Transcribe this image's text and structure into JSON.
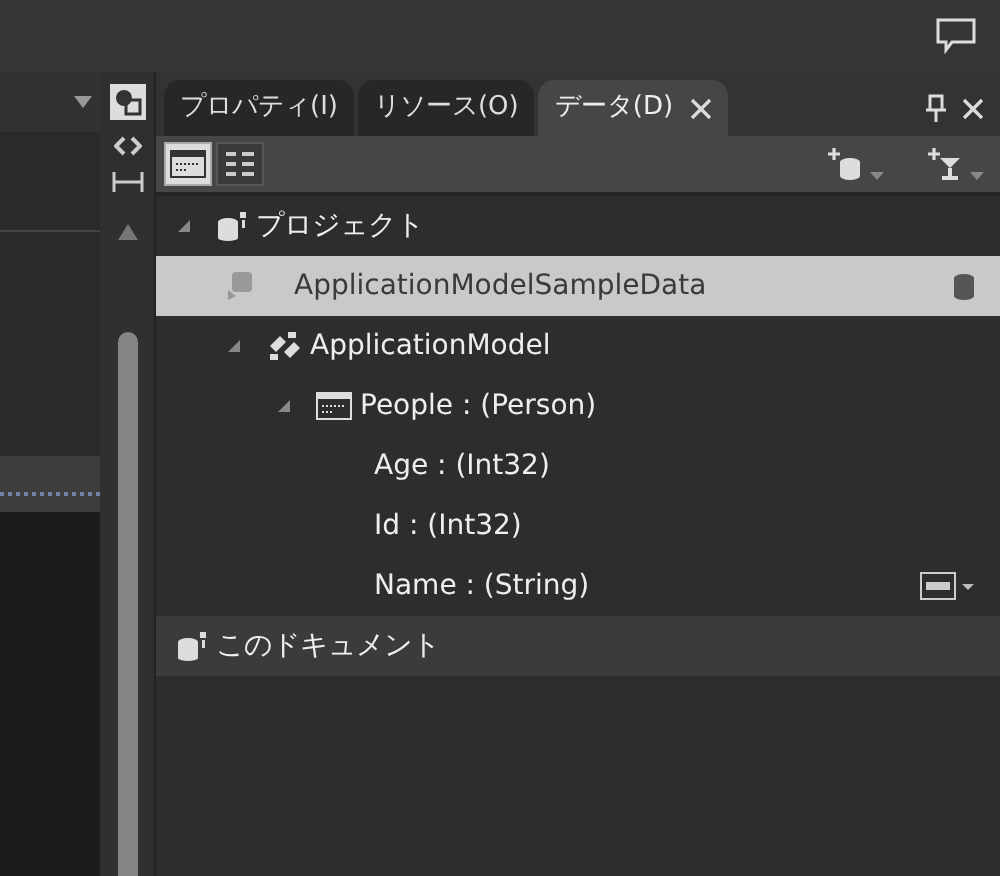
{
  "tabs": [
    {
      "label": "プロパティ(I)",
      "selected": false
    },
    {
      "label": "リソース(O)",
      "selected": false
    },
    {
      "label": "データ(D)",
      "selected": true
    }
  ],
  "view_buttons": [
    {
      "kind": "list",
      "selected": true
    },
    {
      "kind": "details",
      "selected": false
    }
  ],
  "tree": [
    {
      "label": "プロジェクト",
      "kind": "group",
      "expanded": true,
      "selected": false,
      "children": [
        {
          "label": "ApplicationModelSampleData",
          "kind": "source",
          "selected": true,
          "children": [
            {
              "label": "ApplicationModel",
              "kind": "model",
              "expanded": true,
              "selected": false,
              "children": [
                {
                  "label": "People : (Person)",
                  "kind": "collection",
                  "expanded": true,
                  "selected": false,
                  "children": [
                    {
                      "label": "Age : (Int32)",
                      "kind": "field",
                      "selected": false
                    },
                    {
                      "label": "Id : (Int32)",
                      "kind": "field",
                      "selected": false
                    },
                    {
                      "label": "Name : (String)",
                      "kind": "string-field",
                      "selected": false
                    }
                  ]
                }
              ]
            }
          ]
        }
      ]
    },
    {
      "label": "このドキュメント",
      "kind": "document",
      "selected": false
    }
  ]
}
